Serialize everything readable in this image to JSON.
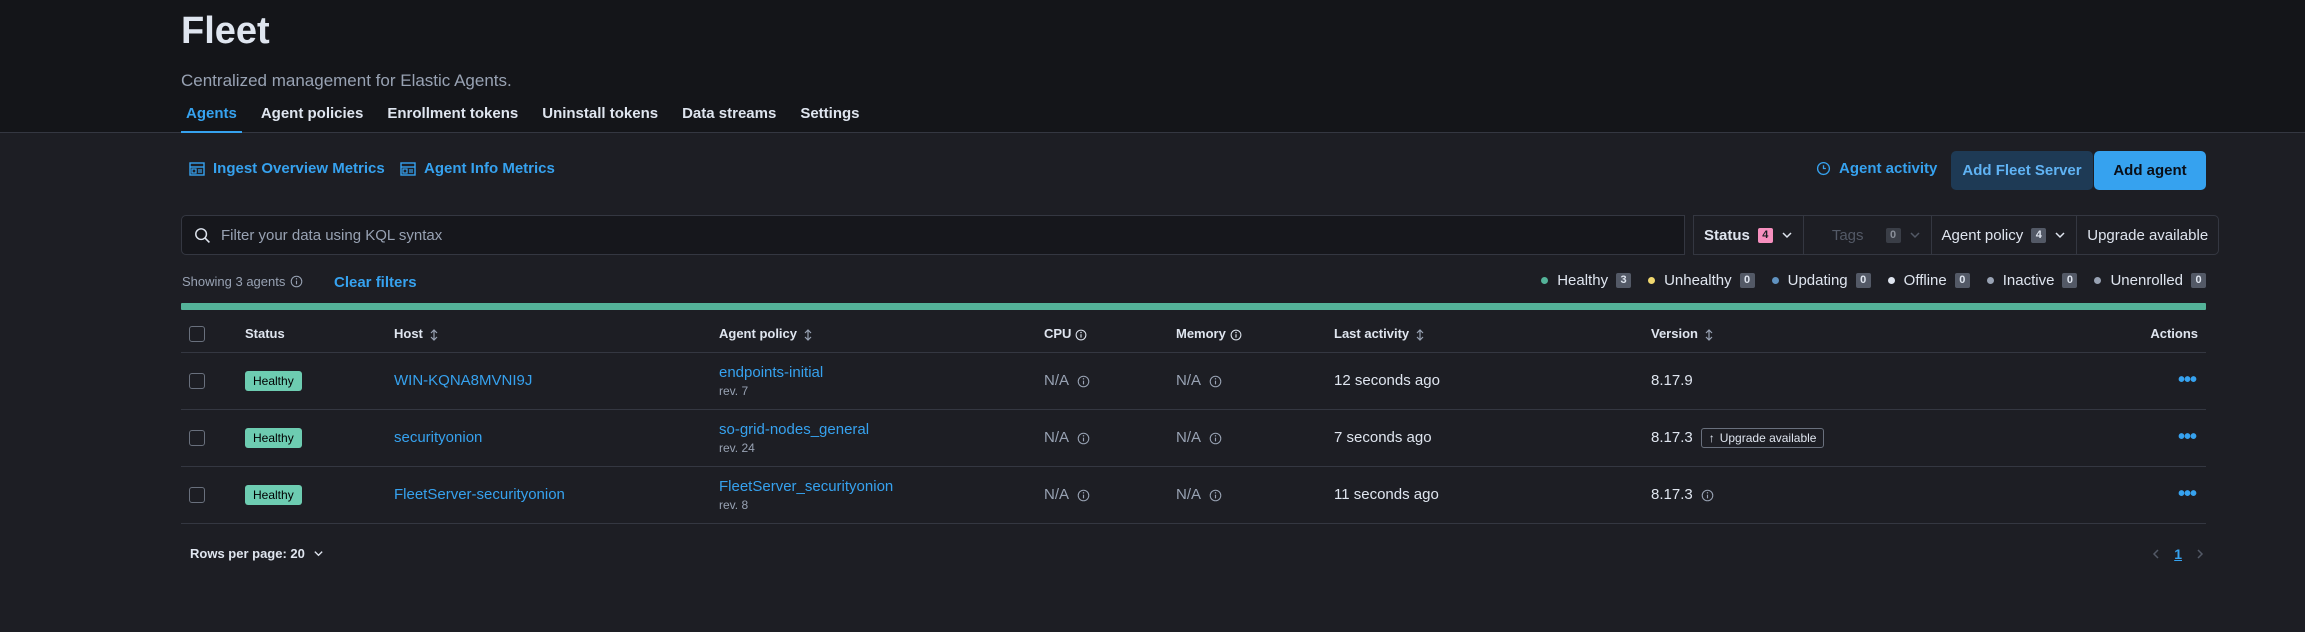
{
  "header": {
    "title": "Fleet",
    "description": "Centralized management for Elastic Agents.",
    "tabs": [
      {
        "label": "Agents"
      },
      {
        "label": "Agent policies"
      },
      {
        "label": "Enrollment tokens"
      },
      {
        "label": "Uninstall tokens"
      },
      {
        "label": "Data streams"
      },
      {
        "label": "Settings"
      }
    ]
  },
  "toolbar": {
    "ingest_metrics": "Ingest Overview Metrics",
    "agent_info_metrics": "Agent Info Metrics",
    "agent_activity": "Agent activity",
    "add_fleet_server": "Add Fleet Server",
    "add_agent": "Add agent"
  },
  "search": {
    "placeholder": "Filter your data using KQL syntax",
    "value": ""
  },
  "filters": {
    "status": {
      "label": "Status",
      "count": "4"
    },
    "tags": {
      "label": "Tags",
      "count": "0"
    },
    "agent_policy": {
      "label": "Agent policy",
      "count": "4"
    },
    "upgrade_available": {
      "label": "Upgrade available"
    }
  },
  "summary": {
    "showing": "Showing 3 agents",
    "clear_filters": "Clear filters",
    "legend": [
      {
        "label": "Healthy",
        "count": "3",
        "color": "#54b399"
      },
      {
        "label": "Unhealthy",
        "count": "0",
        "color": "#f1d86f"
      },
      {
        "label": "Updating",
        "count": "0",
        "color": "#6092c0"
      },
      {
        "label": "Offline",
        "count": "0",
        "color": "#dfe5ef"
      },
      {
        "label": "Inactive",
        "count": "0",
        "color": "#98a2b3"
      },
      {
        "label": "Unenrolled",
        "count": "0",
        "color": "#98a2b3"
      }
    ]
  },
  "table": {
    "columns": {
      "status": "Status",
      "host": "Host",
      "agent_policy": "Agent policy",
      "cpu": "CPU",
      "memory": "Memory",
      "last_activity": "Last activity",
      "version": "Version",
      "actions": "Actions"
    },
    "rows": [
      {
        "status": "Healthy",
        "host": "WIN-KQNA8MVNI9J",
        "policy": "endpoints-initial",
        "rev": "rev. 7",
        "cpu": "N/A",
        "memory": "N/A",
        "last_activity": "12 seconds ago",
        "version": "8.17.9"
      },
      {
        "status": "Healthy",
        "host": "securityonion",
        "policy": "so-grid-nodes_general",
        "rev": "rev. 24",
        "cpu": "N/A",
        "memory": "N/A",
        "last_activity": "7 seconds ago",
        "version": "8.17.3",
        "upgrade": "Upgrade available"
      },
      {
        "status": "Healthy",
        "host": "FleetServer-securityonion",
        "policy": "FleetServer_securityonion",
        "rev": "rev. 8",
        "cpu": "N/A",
        "memory": "N/A",
        "last_activity": "11 seconds ago",
        "version": "8.17.3"
      }
    ]
  },
  "pagination": {
    "rows_per_page": "Rows per page: 20",
    "current_page": "1"
  }
}
